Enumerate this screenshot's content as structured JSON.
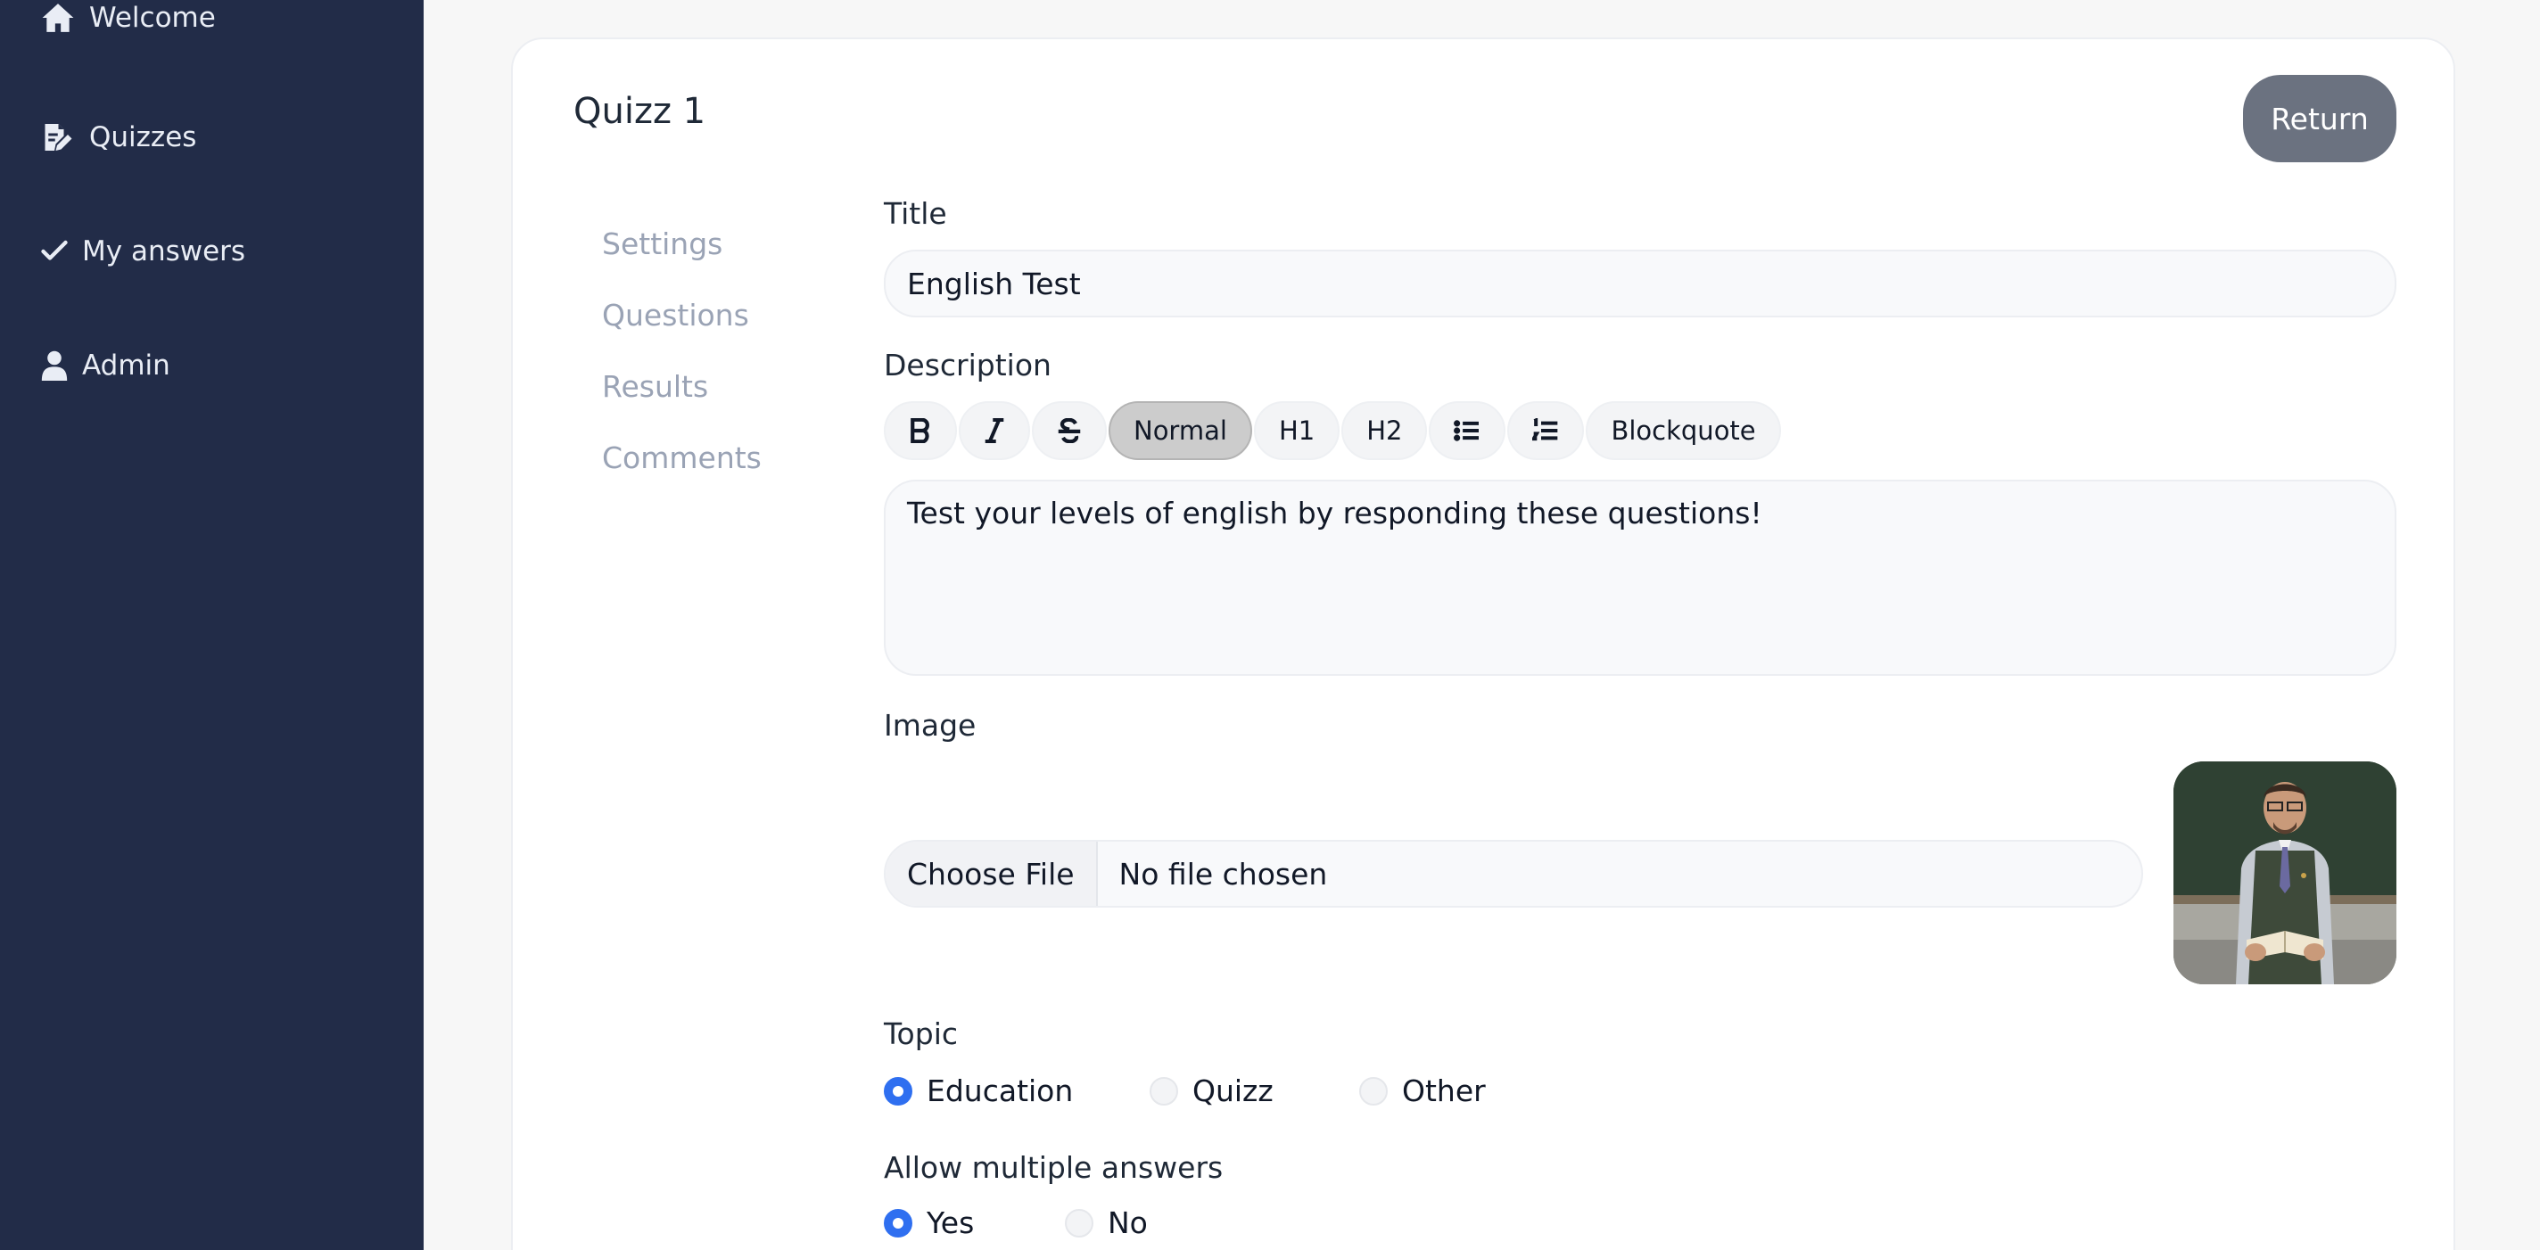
{
  "sidebar": {
    "items": [
      {
        "label": "Welcome",
        "icon": "home-icon"
      },
      {
        "label": "Quizzes",
        "icon": "edit-document-icon"
      },
      {
        "label": "My answers",
        "icon": "check-icon"
      },
      {
        "label": "Admin",
        "icon": "user-icon"
      }
    ]
  },
  "card": {
    "title": "Quizz 1",
    "return_label": "Return"
  },
  "subnav": {
    "items": [
      {
        "label": "Settings"
      },
      {
        "label": "Questions"
      },
      {
        "label": "Results"
      },
      {
        "label": "Comments"
      }
    ]
  },
  "form": {
    "title_label": "Title",
    "title_value": "English Test",
    "description_label": "Description",
    "toolbar": {
      "bold": "B",
      "italic": "I",
      "strike": "S",
      "normal": "Normal",
      "h1": "H1",
      "h2": "H2",
      "bullet_list": "bullet-list-icon",
      "ordered_list": "ordered-list-icon",
      "blockquote": "Blockquote"
    },
    "description_value": "Test your levels of english by responding these questions!",
    "image_label": "Image",
    "file_button": "Choose File",
    "file_status": "No file chosen",
    "topic_label": "Topic",
    "topic_options": [
      {
        "label": "Education",
        "checked": true
      },
      {
        "label": "Quizz",
        "checked": false
      },
      {
        "label": "Other",
        "checked": false
      }
    ],
    "multiple_label": "Allow multiple answers",
    "multiple_options": [
      {
        "label": "Yes",
        "checked": true
      },
      {
        "label": "No",
        "checked": false
      }
    ]
  },
  "colors": {
    "sidebar": "#222c48",
    "accent": "#2f6ff0",
    "return_button": "#6b7280"
  }
}
